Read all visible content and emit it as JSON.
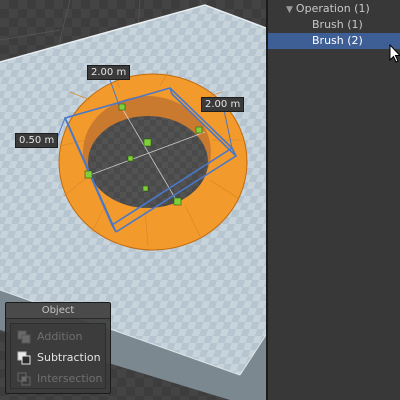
{
  "scene": {
    "dimension_labels": [
      "2.00 m",
      "2.00 m",
      "0.50 m"
    ]
  },
  "object_panel": {
    "title": "Object",
    "operations": [
      {
        "label": "Addition",
        "state": "disabled",
        "icon": "addition-icon"
      },
      {
        "label": "Subtraction",
        "state": "active",
        "icon": "subtraction-icon"
      },
      {
        "label": "Intersection",
        "state": "disabled",
        "icon": "intersection-icon"
      }
    ]
  },
  "hierarchy": {
    "items": [
      {
        "label": "Operation (1)",
        "selected": false,
        "expanded": true
      },
      {
        "label": "Brush (1)",
        "selected": false
      },
      {
        "label": "Brush (2)",
        "selected": true
      }
    ]
  },
  "colors": {
    "selection": "#3e5f96",
    "ring": "#f39a2c",
    "handle": "#7fcf3a",
    "bounds": "#4a78c8"
  },
  "icons": {
    "tree_arrow": "▼",
    "cursor": "mouse-pointer-icon"
  }
}
